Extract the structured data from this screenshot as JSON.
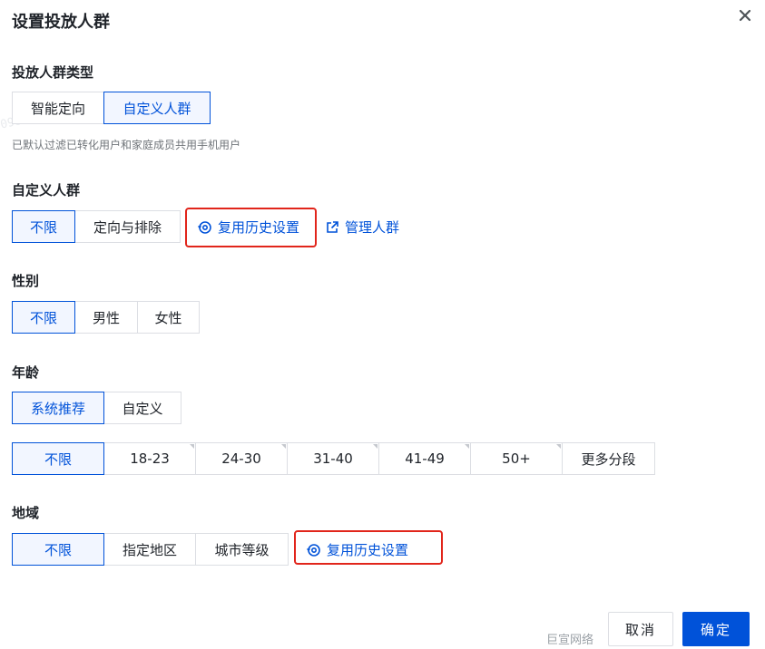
{
  "dialog": {
    "title": "设置投放人群",
    "close_icon": "close-icon"
  },
  "audience_type": {
    "label": "投放人群类型",
    "options": [
      "智能定向",
      "自定义人群"
    ],
    "selected": "自定义人群",
    "hint": "已默认过滤已转化用户和家庭成员共用手机用户"
  },
  "custom_audience": {
    "label": "自定义人群",
    "options": [
      "不限",
      "定向与排除"
    ],
    "selected": "不限",
    "reuse_label": "复用历史设置",
    "manage_label": "管理人群"
  },
  "gender": {
    "label": "性别",
    "options": [
      "不限",
      "男性",
      "女性"
    ],
    "selected": "不限"
  },
  "age": {
    "label": "年龄",
    "mode_options": [
      "系统推荐",
      "自定义"
    ],
    "mode_selected": "系统推荐",
    "ranges": [
      "不限",
      "18-23",
      "24-30",
      "31-40",
      "41-49",
      "50+",
      "更多分段"
    ],
    "range_selected": "不限"
  },
  "region": {
    "label": "地域",
    "options": [
      "不限",
      "指定地区",
      "城市等级"
    ],
    "selected": "不限",
    "reuse_label": "复用历史设置"
  },
  "footer": {
    "watermark": "巨宣网络",
    "cancel_label": "取消",
    "ok_label": "确定"
  },
  "colors": {
    "accent": "#0052d9",
    "highlight_border": "#e1251b"
  }
}
